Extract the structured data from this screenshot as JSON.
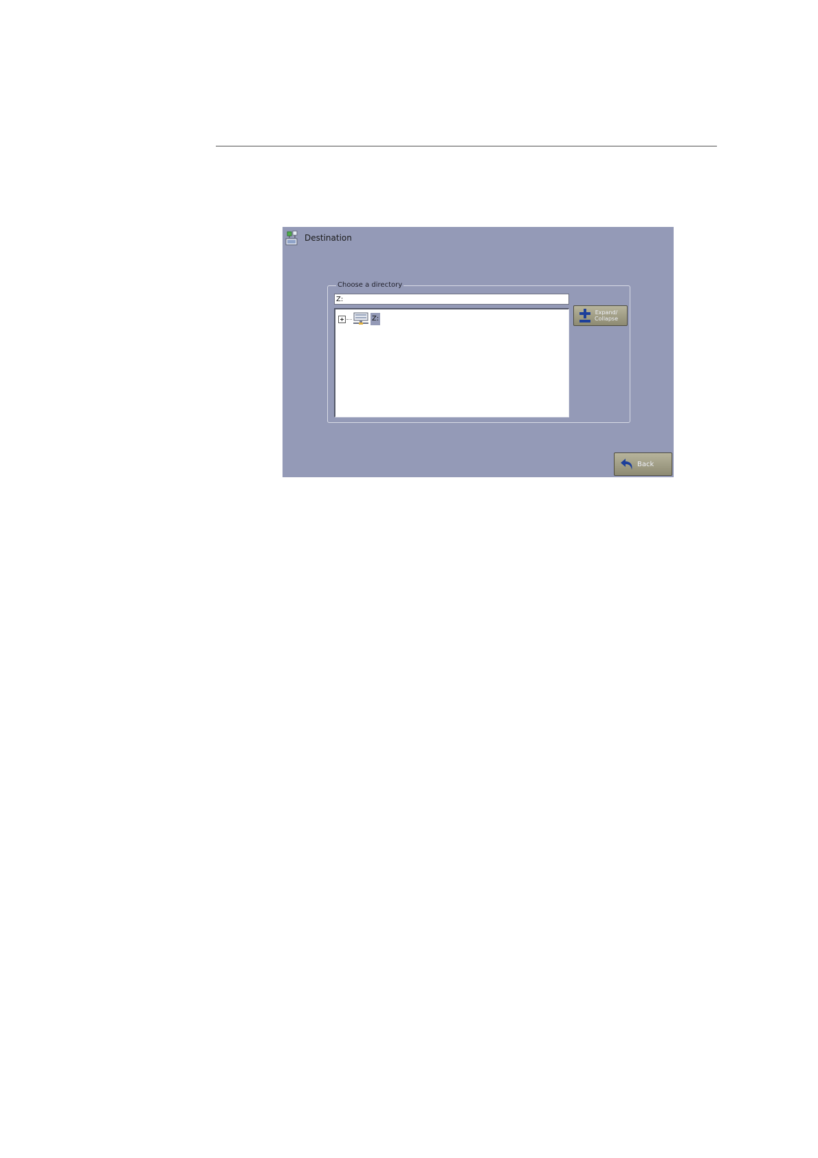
{
  "window": {
    "title": "Destination",
    "icon": "app-icon"
  },
  "directory_group": {
    "legend": "Choose a directory",
    "path_value": "Z:",
    "tree": [
      {
        "label": "Z:",
        "icon": "network-drive-icon",
        "expanded": false,
        "selected": true
      }
    ]
  },
  "buttons": {
    "expand_collapse_label": "Expand/\nCollapse",
    "back_label": "Back"
  },
  "colors": {
    "screen_bg": "#949ab7",
    "button_bg": "#a3a087",
    "selection_bg": "#949ab7"
  }
}
